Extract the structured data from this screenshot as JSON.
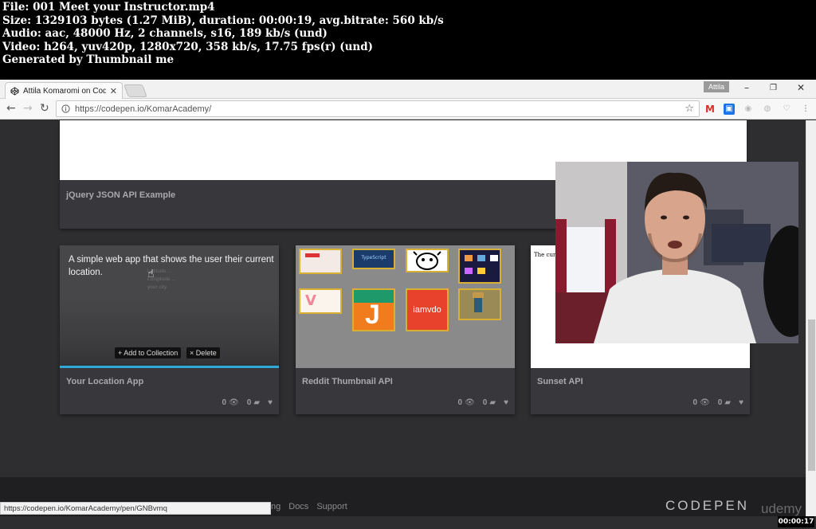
{
  "info": {
    "file": "File: 001 Meet your Instructor.mp4",
    "size": "Size: 1329103 bytes (1.27 MiB), duration: 00:00:19, avg.bitrate: 560 kb/s",
    "audio": "Audio: aac, 48000 Hz, 2 channels, s16, 189 kb/s (und)",
    "video": "Video: h264, yuv420p, 1280x720, 358 kb/s, 17.75 fps(r) (und)",
    "generator": "Generated by Thumbnail me"
  },
  "browser": {
    "tab_title": "Attila Komaromi on Code",
    "user_badge": "Attila",
    "url": "https://codepen.io/KomarAcademy/",
    "status_url": "https://codepen.io/KomarAcademy/pen/GNBvmq"
  },
  "page": {
    "top_card_title": "jQuery JSON API Example",
    "cards": [
      {
        "title": "Your Location App",
        "description": "A simple web app that shows the user their current location.",
        "add_button": "+ Add to Collection",
        "delete_button": "× Delete",
        "views": "0",
        "comments": "0"
      },
      {
        "title": "Reddit Thumbnail API",
        "views": "0",
        "comments": "0",
        "thumb_labels": [
          "TypeScript",
          "J",
          "iamvdo"
        ]
      },
      {
        "title": "Sunset API",
        "preview_text": "The curre",
        "views": "0",
        "comments": "0"
      }
    ],
    "footer_links": [
      "ng",
      "Docs",
      "Support"
    ],
    "codepen_logo": "CODEPEN",
    "udemy_logo": "udemy"
  },
  "timestamp": "00:00:17",
  "colors": {
    "page_bg": "#2e2e31",
    "card_bg": "#38383c",
    "underline_accent": "#2fa9d6"
  }
}
